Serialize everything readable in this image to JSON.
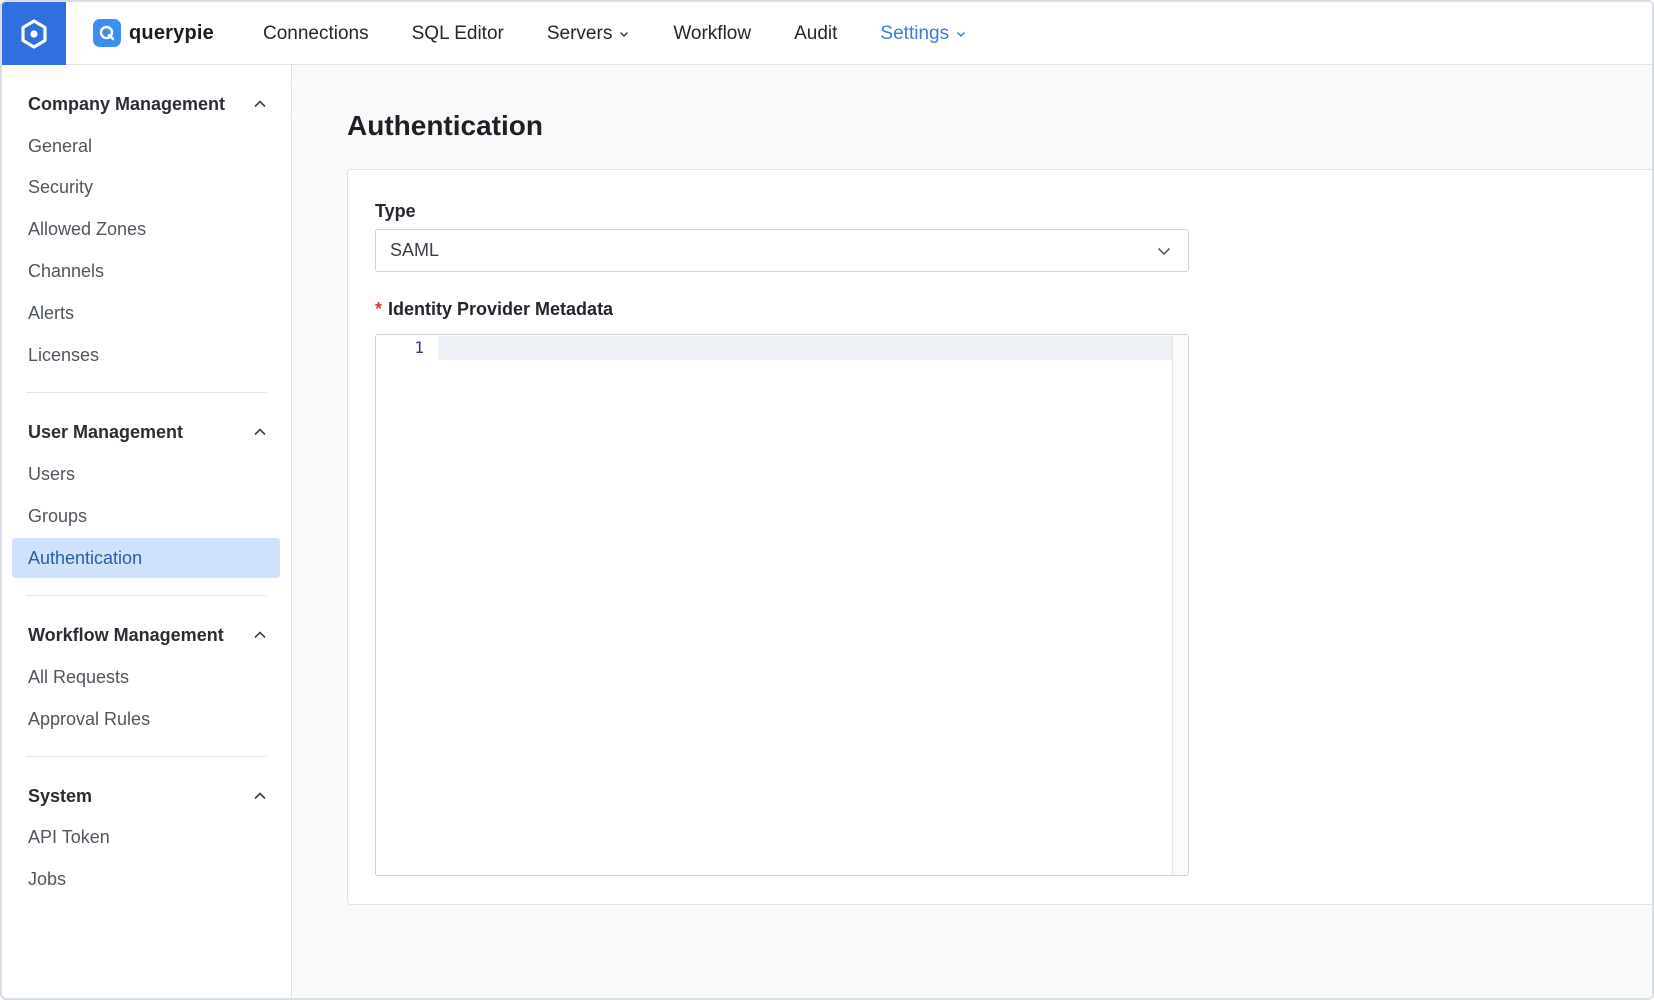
{
  "header": {
    "brand_name": "querypie",
    "nav": [
      {
        "label": "Connections",
        "has_dropdown": false
      },
      {
        "label": "SQL Editor",
        "has_dropdown": false
      },
      {
        "label": "Servers",
        "has_dropdown": true
      },
      {
        "label": "Workflow",
        "has_dropdown": false
      },
      {
        "label": "Audit",
        "has_dropdown": false
      },
      {
        "label": "Settings",
        "has_dropdown": true,
        "active": true
      }
    ],
    "accent_color": "#3b7ddd"
  },
  "sidebar": {
    "sections": [
      {
        "title": "Company Management",
        "items": [
          "General",
          "Security",
          "Allowed Zones",
          "Channels",
          "Alerts",
          "Licenses"
        ]
      },
      {
        "title": "User Management",
        "items": [
          "Users",
          "Groups",
          "Authentication"
        ]
      },
      {
        "title": "Workflow Management",
        "items": [
          "All Requests",
          "Approval Rules"
        ]
      },
      {
        "title": "System",
        "items": [
          "API Token",
          "Jobs"
        ]
      }
    ],
    "active_item": "Authentication"
  },
  "main": {
    "title": "Authentication",
    "type_label": "Type",
    "type_value": "SAML",
    "metadata_required_mark": "*",
    "metadata_label": "Identity Provider Metadata",
    "editor_line_number": "1"
  }
}
